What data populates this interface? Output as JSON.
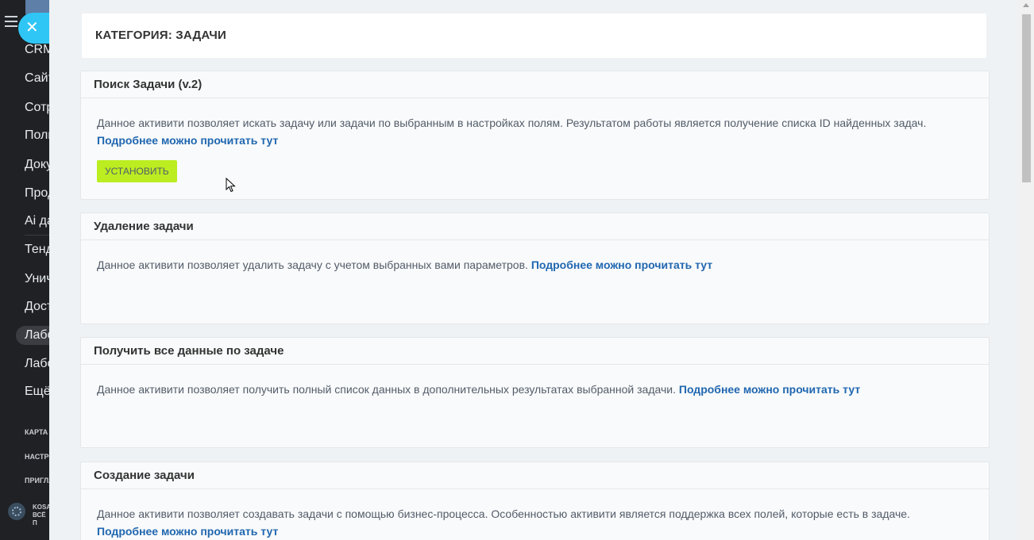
{
  "sidebar": {
    "items": [
      {
        "label": "CRM"
      },
      {
        "label": "Сайты"
      },
      {
        "label": "Сотрудники"
      },
      {
        "label": "Пользователи"
      },
      {
        "label": "Документы"
      },
      {
        "label": "Продажи"
      },
      {
        "label": "Ai даты"
      },
      {
        "label": "Тендеры"
      },
      {
        "label": "Уничтожение"
      },
      {
        "label": "Доступ"
      },
      {
        "label": "Лаборатория",
        "active": true
      },
      {
        "label": "Лаборатория"
      },
      {
        "label": "Ещё"
      }
    ],
    "sections": [
      "КАРТА",
      "НАСТРОЙКИ",
      "ПРИГЛАСИТЬ"
    ],
    "bottom": {
      "line1": "KOSA",
      "line2": "ВСЁ П"
    }
  },
  "close_icon": "✕",
  "category": {
    "title": "КАТЕГОРИЯ: ЗАДАЧИ"
  },
  "cards": [
    {
      "title": "Поиск Задачи (v.2)",
      "description": "Данное активити позволяет искать задачу или задачи по выбранным в настройках полям. Результатом работы является получение списка ID найденных задач.",
      "link": "Подробнее можно прочитать тут",
      "button": "УСТАНОВИТЬ"
    },
    {
      "title": "Удаление задачи",
      "description": "Данное активити позволяет удалить задачу с учетом выбранных вами параметров.",
      "link": "Подробнее можно прочитать тут"
    },
    {
      "title": "Получить все данные по задаче",
      "description": "Данное активити позволяет получить полный список данных в дополнительных результатах выбранной задачи.",
      "link": "Подробнее можно прочитать тут"
    },
    {
      "title": "Создание задачи",
      "description": "Данное активити позволяет создавать задачи с помощью бизнес-процесса. Особенностью активити является поддержка всех полей, которые есть в задаче.",
      "link": "Подробнее можно прочитать тут"
    }
  ],
  "colors": {
    "accent_link": "#2067b0",
    "install_button": "#bbed21",
    "close_button": "#2fc6f6"
  }
}
